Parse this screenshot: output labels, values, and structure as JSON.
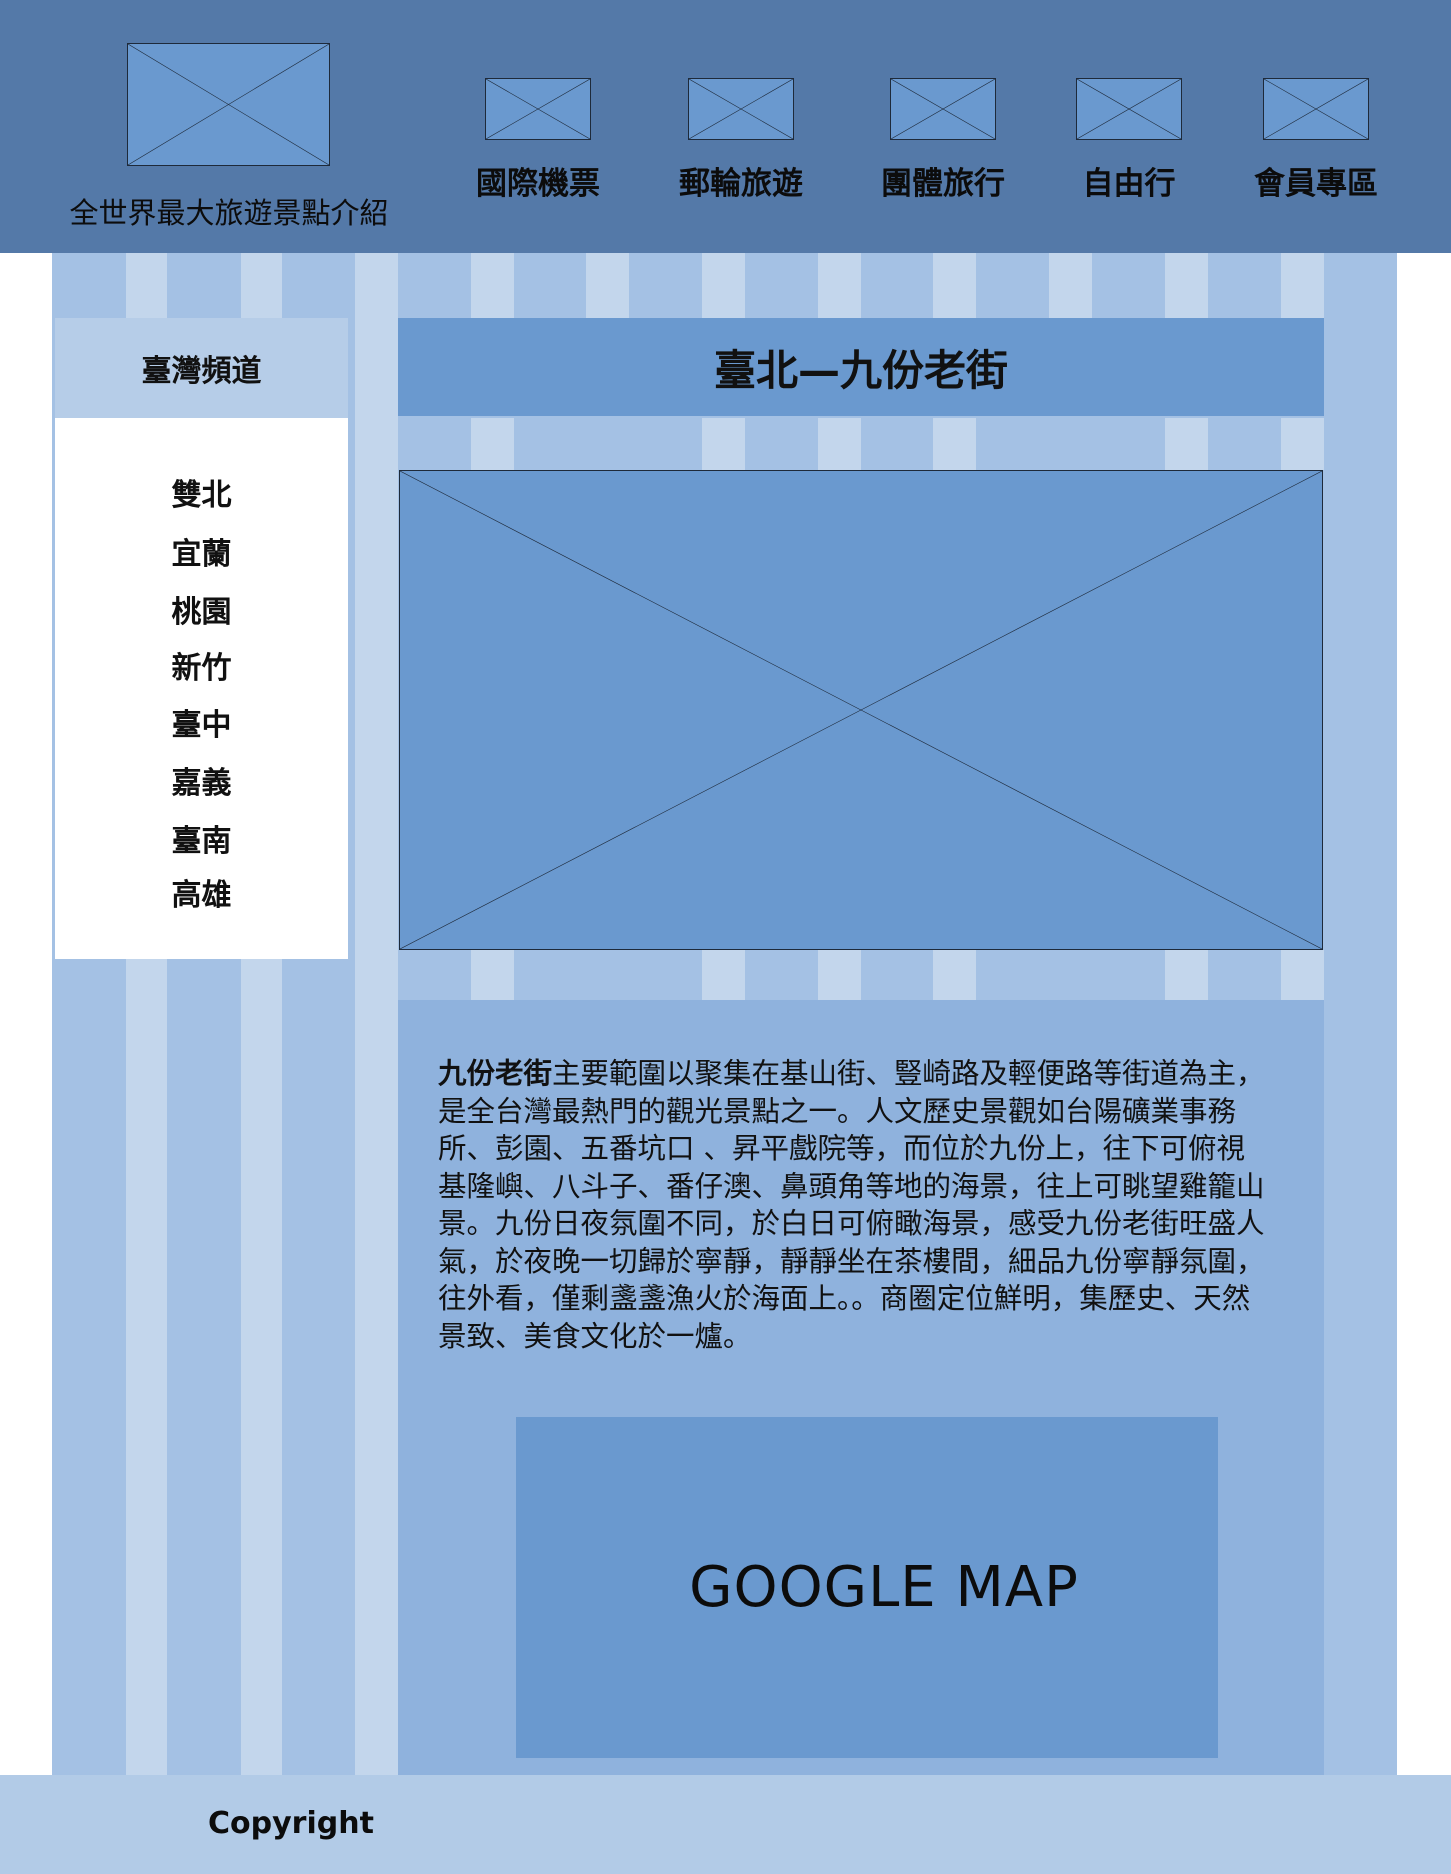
{
  "header": {
    "site_title": "全世界最大旅遊景點介紹",
    "nav": [
      {
        "label": "國際機票"
      },
      {
        "label": "郵輪旅遊"
      },
      {
        "label": "團體旅行"
      },
      {
        "label": "自由行"
      },
      {
        "label": "會員專區"
      }
    ]
  },
  "sidebar": {
    "title": "臺灣頻道",
    "items": [
      {
        "label": "雙北"
      },
      {
        "label": "宜蘭"
      },
      {
        "label": "桃園"
      },
      {
        "label": "新竹"
      },
      {
        "label": "臺中"
      },
      {
        "label": "嘉義"
      },
      {
        "label": "臺南"
      },
      {
        "label": "高雄"
      }
    ]
  },
  "main": {
    "title": "臺北—九份老街",
    "description": {
      "lead": "九份老街",
      "body": "主要範圍以聚集在基山街、豎崎路及輕便路等街道為主，是全台灣最熱門的觀光景點之一。人文歷史景觀如台陽礦業事務所、彭園、五番坑口 、昇平戲院等，而位於九份上，往下可俯視基隆嶼、八斗子、番仔澳、鼻頭角等地的海景，往上可眺望雞籠山景。九份日夜氛圍不同，於白日可俯瞰海景，感受九份老街旺盛人氣，於夜晚一切歸於寧靜，靜靜坐在茶樓間，細品九份寧靜氛圍，往外看，僅剩盞盞漁火於海面上。。商圈定位鮮明，集歷史、天然景致、美食文化於一爐。"
    },
    "map_label": "GOOGLE MAP"
  },
  "footer": {
    "copyright": "Copyright"
  },
  "colors": {
    "header_bg": "#5479a8",
    "placeholder": "#6a99cf",
    "column_light": "#a4c1e4",
    "column_pale": "#c3d6ec",
    "panel": "#8fb2dd",
    "footer_bg": "#b2cbe7"
  }
}
